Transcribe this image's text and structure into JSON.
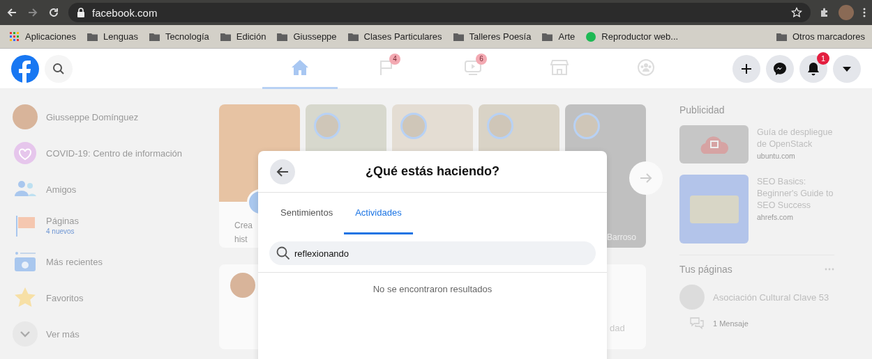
{
  "browser": {
    "address": "facebook.com",
    "bookmarks": [
      {
        "label": "Aplicaciones",
        "kind": "apps"
      },
      {
        "label": "Lenguas",
        "kind": "folder"
      },
      {
        "label": "Tecnología",
        "kind": "folder"
      },
      {
        "label": "Edición",
        "kind": "folder"
      },
      {
        "label": "Giusseppe",
        "kind": "folder"
      },
      {
        "label": "Clases Particulares",
        "kind": "folder"
      },
      {
        "label": "Talleres Poesía",
        "kind": "folder"
      },
      {
        "label": "Arte",
        "kind": "folder"
      },
      {
        "label": "Reproductor web...",
        "kind": "site"
      }
    ],
    "other_bookmarks": "Otros marcadores"
  },
  "header": {
    "nav_tabs": [
      {
        "kind": "home",
        "selected": true
      },
      {
        "kind": "flag",
        "selected": false,
        "badge": "4"
      },
      {
        "kind": "video",
        "selected": false,
        "badge": "6"
      },
      {
        "kind": "store",
        "selected": false
      },
      {
        "kind": "groups",
        "selected": false
      }
    ],
    "actions": [
      {
        "kind": "plus"
      },
      {
        "kind": "messenger"
      },
      {
        "kind": "bell",
        "badge": "1"
      },
      {
        "kind": "caret"
      }
    ]
  },
  "sidebar": {
    "items": [
      {
        "label": "Giusseppe Domínguez",
        "kind": "avatar"
      },
      {
        "label": "COVID-19: Centro de información",
        "kind": "covid"
      },
      {
        "label": "Amigos",
        "kind": "friends"
      },
      {
        "label": "Páginas",
        "kind": "pages",
        "note": "4 nuevos"
      },
      {
        "label": "Más recientes",
        "kind": "recent"
      },
      {
        "label": "Favoritos",
        "kind": "star"
      },
      {
        "label": "Ver más",
        "kind": "more"
      }
    ]
  },
  "stories": [
    {
      "kind": "create",
      "lines": [
        "Crea",
        "hist"
      ]
    },
    {
      "kind": "story"
    },
    {
      "kind": "story"
    },
    {
      "kind": "story"
    },
    {
      "kind": "story",
      "name": "Barroso"
    }
  ],
  "composer": {
    "action_fragment": "dad"
  },
  "modal": {
    "title": "¿Qué estás haciendo?",
    "tabs": [
      {
        "label": "Sentimientos",
        "selected": false
      },
      {
        "label": "Actividades",
        "selected": true
      }
    ],
    "search": {
      "value": "reflexionando"
    },
    "empty_message": "No se encontraron resultados"
  },
  "right": {
    "ads_heading": "Publicidad",
    "ads": [
      {
        "title": "Guía de despliegue de OpenStack",
        "domain": "ubuntu.com",
        "kind": "cloud"
      },
      {
        "title": "SEO Basics: Beginner's Guide to SEO Success",
        "domain": "ahrefs.com",
        "kind": "seo"
      }
    ],
    "pages_heading": "Tus páginas",
    "pages": [
      {
        "name": "Asociación Cultural Clave 53",
        "stats": [
          "1 Mensaje"
        ]
      }
    ]
  }
}
